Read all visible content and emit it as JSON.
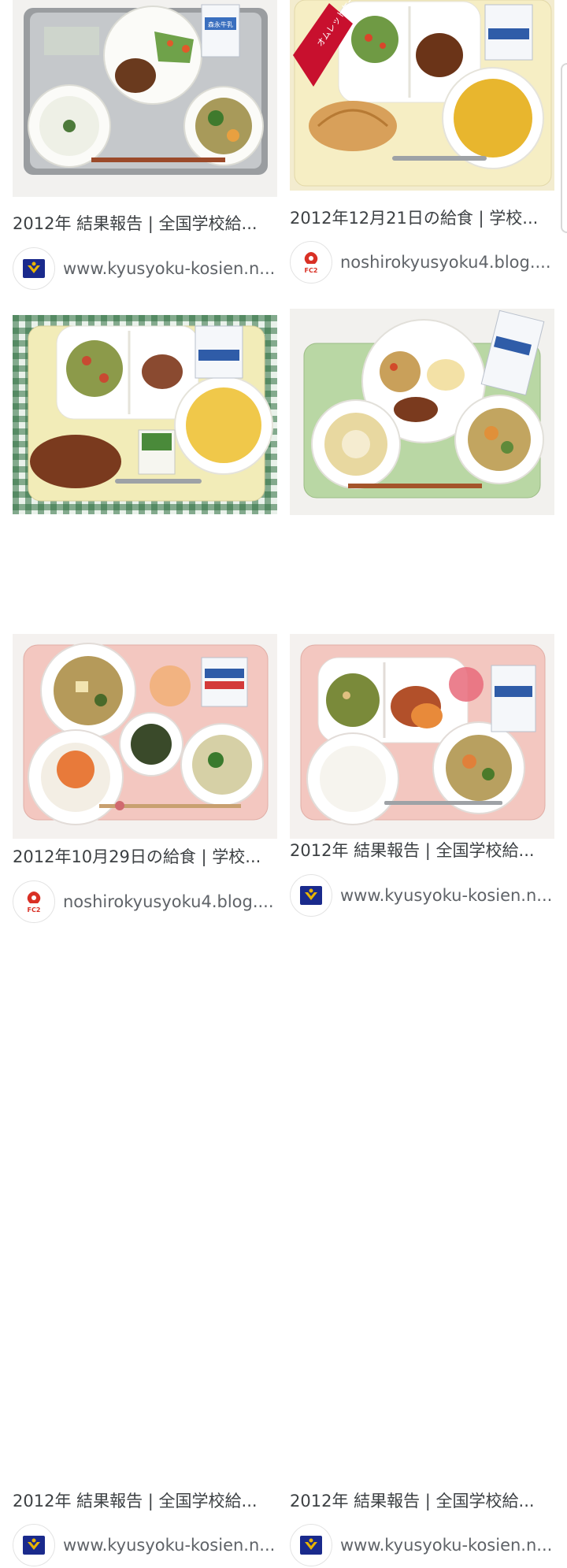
{
  "results": [
    {
      "title": "2012年 結果報告 | 全国学校給...",
      "domain": "www.kyusyoku-kosien.n...",
      "favicon": "kosien-emblem-icon"
    },
    {
      "title": "2012年12月21日の給食 | 学校...",
      "domain": "noshirokyusyoku4.blog....",
      "favicon": "fc2-blog-icon"
    },
    {
      "title": "2012年10月29日の給食 | 学校...",
      "domain": "noshirokyusyoku4.blog....",
      "favicon": "fc2-blog-icon"
    },
    {
      "title": "2012年 結果報告 | 全国学校給...",
      "domain": "www.kyusyoku-kosien.n...",
      "favicon": "kosien-emblem-icon"
    },
    {
      "title": "2012年 結果報告 | 全国学校給...",
      "domain": "www.kyusyoku-kosien.n...",
      "favicon": "kosien-emblem-icon"
    },
    {
      "title": "2012年 結果報告 | 全国学校給...",
      "domain": "www.kyusyoku-kosien.n...",
      "favicon": "kosien-emblem-icon"
    }
  ],
  "image_labels": {
    "omelet_cake": "オムレットケーキ",
    "milk_brand": "森永牛乳"
  },
  "colors": {
    "text": "#3c4043",
    "domain_text": "#5f6368",
    "kosien_blue": "#1a2a8c",
    "kosien_gold": "#e8b400",
    "fc2_red": "#d93025"
  }
}
